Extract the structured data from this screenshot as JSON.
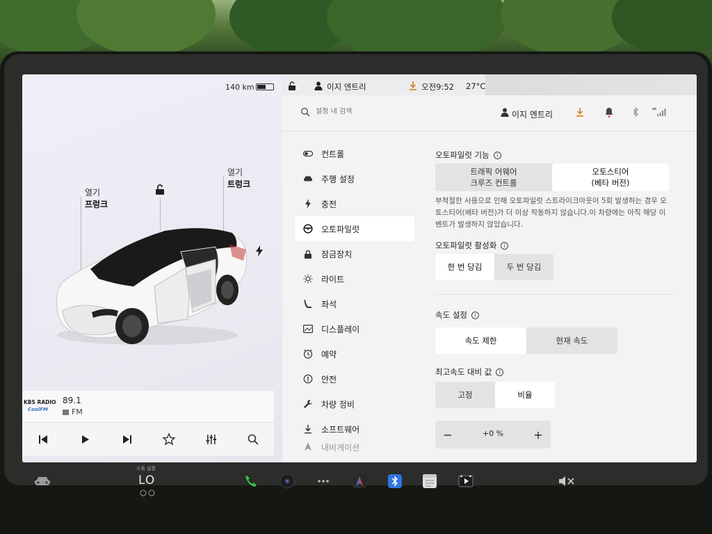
{
  "status": {
    "range": "140 km",
    "battery_level": 0.55,
    "driver_profile": "이지 엔트리",
    "time": "오전9:52",
    "temperature": "27°C"
  },
  "left": {
    "frunk": {
      "state": "열기",
      "name": "프렁크"
    },
    "trunk": {
      "state": "열기",
      "name": "트렁크"
    },
    "media": {
      "station_logo_line1": "KBS RADIO",
      "station_logo_line2": "CoolFM",
      "frequency": "89.1",
      "band": "FM"
    }
  },
  "settings": {
    "search_placeholder": "설정 내 검색",
    "user": "이지 엔트리",
    "menu": [
      {
        "label": "컨트롤",
        "icon": "toggle-icon"
      },
      {
        "label": "주행 설정",
        "icon": "car-icon"
      },
      {
        "label": "충전",
        "icon": "bolt-icon"
      },
      {
        "label": "오토파일럿",
        "icon": "steering-wheel-icon",
        "active": true
      },
      {
        "label": "잠금장치",
        "icon": "lock-icon"
      },
      {
        "label": "라이트",
        "icon": "sun-icon"
      },
      {
        "label": "좌석",
        "icon": "seat-icon"
      },
      {
        "label": "디스플레이",
        "icon": "display-icon"
      },
      {
        "label": "예약",
        "icon": "clock-icon"
      },
      {
        "label": "안전",
        "icon": "safety-icon"
      },
      {
        "label": "차량 정비",
        "icon": "wrench-icon"
      },
      {
        "label": "소프트웨어",
        "icon": "download-icon"
      },
      {
        "label": "내비게이션",
        "icon": "navigation-icon"
      }
    ],
    "autopilot_features": {
      "label": "오토파일럿 기능",
      "options": [
        {
          "line1": "트래픽 어웨어",
          "line2": "크루즈 컨트롤"
        },
        {
          "line1": "오토스티어",
          "line2": "(베타 버전)",
          "selected": true
        }
      ],
      "description": "부적절한 사용으로 인해 오토파일럿 스트라이크아웃이 5회 발생하는 경우 오토스티어(베타 버전)가 더 이상 작동하지 않습니다.이 차량에는 아직 해당 이벤트가 발생하지 않았습니다."
    },
    "autopilot_activation": {
      "label": "오토파일럿 활성화",
      "options": [
        "한 번 당김",
        "두 번 당김"
      ],
      "selected": 0
    },
    "speed_setting": {
      "label": "속도 설정",
      "options": [
        "속도 제한",
        "현재 속도"
      ],
      "selected": 0
    },
    "speed_offset": {
      "label": "최고속도 대비 값",
      "options": [
        "고정",
        "비율"
      ],
      "selected": 1,
      "value": "+0 %",
      "minus": "−",
      "plus": "+"
    }
  },
  "dock": {
    "climate_caption": "수동 설정",
    "climate_value": "LO"
  }
}
